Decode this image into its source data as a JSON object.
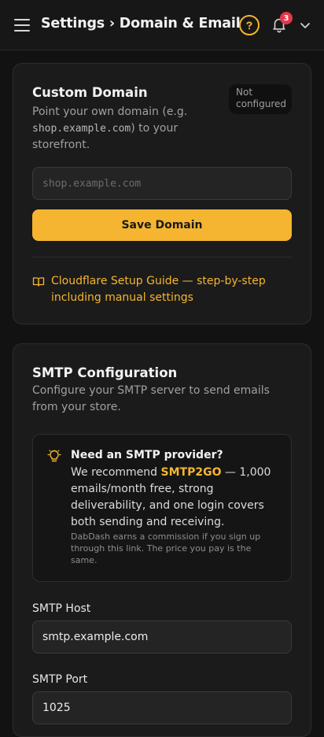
{
  "header": {
    "title": "Settings › Domain & Email",
    "help_icon": "question-circle-icon",
    "notification_count": "3"
  },
  "custom_domain": {
    "title": "Custom Domain",
    "desc_before": "Point your own domain (e.g. ",
    "desc_example": "shop.example.com",
    "desc_after": ") to your storefront.",
    "status_line1": "Not",
    "status_line2": "configured",
    "input_placeholder": "shop.example.com",
    "save_label": "Save Domain",
    "guide_link": "Cloudflare Setup Guide — step-by-step including manual settings"
  },
  "smtp": {
    "title": "SMTP Configuration",
    "desc": "Configure your SMTP server to send emails from your store.",
    "provider": {
      "title": "Need an SMTP provider?",
      "body_before": "We recommend ",
      "link": "SMTP2GO",
      "body_after": " — 1,000 emails/month free, strong deliverability, and one login covers both sending and receiving.",
      "note": "DabDash earns a commission if you sign up through this link. The price you pay is the same."
    },
    "host_label": "SMTP Host",
    "host_value": "smtp.example.com",
    "port_label": "SMTP Port",
    "port_value": "1025"
  },
  "colors": {
    "accent": "#f5b530",
    "background": "#121212",
    "card": "#1b1b1b",
    "badge": "#e5364b"
  }
}
